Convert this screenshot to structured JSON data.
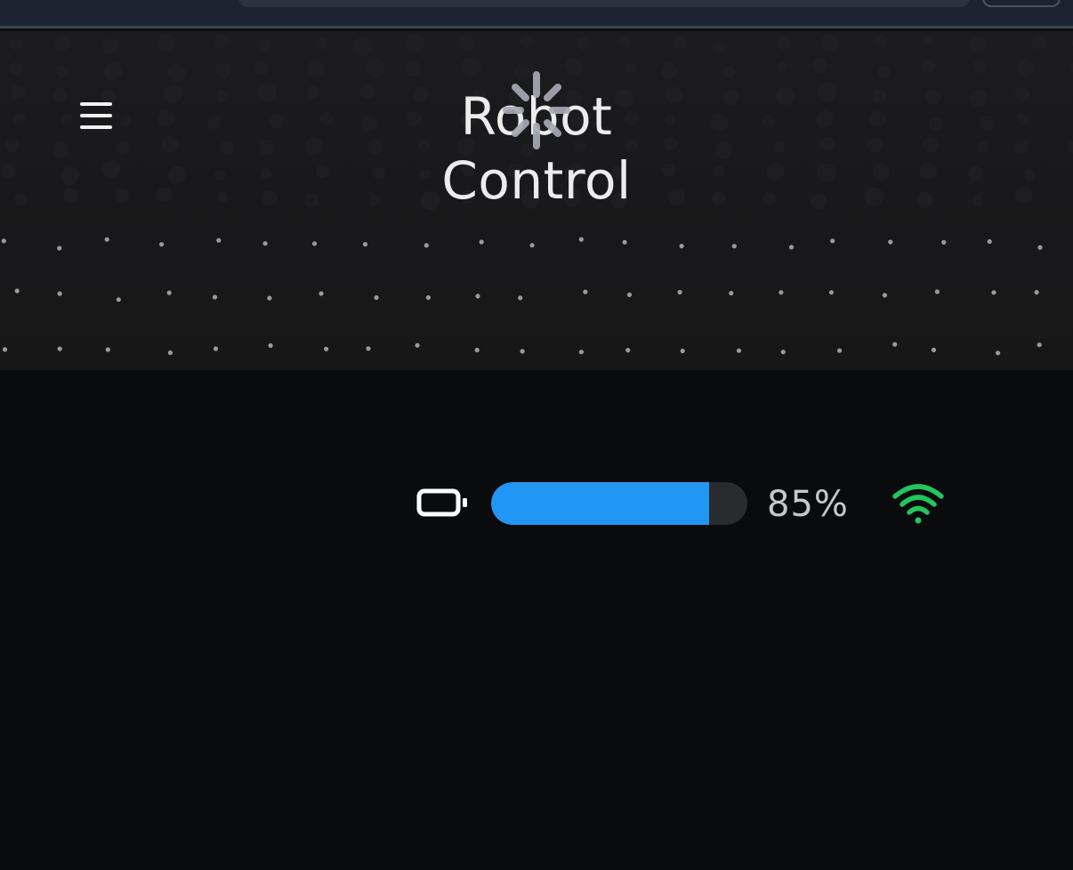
{
  "app": {
    "title": "Robot Control"
  },
  "header": {
    "menu_icon": "hamburger-menu-icon",
    "loading_icon": "spinner-icon"
  },
  "status": {
    "battery_icon": "battery-icon",
    "battery_level": 0.85,
    "battery_label": "85%",
    "connection_icon": "wifi-icon",
    "connection_color": "#22c55e"
  },
  "colors": {
    "background": "#0a0b0d",
    "header_background": "#1c1c1e",
    "accent": "#2196f3",
    "track": "#2a2b2e",
    "text": "#c8c8c8"
  }
}
